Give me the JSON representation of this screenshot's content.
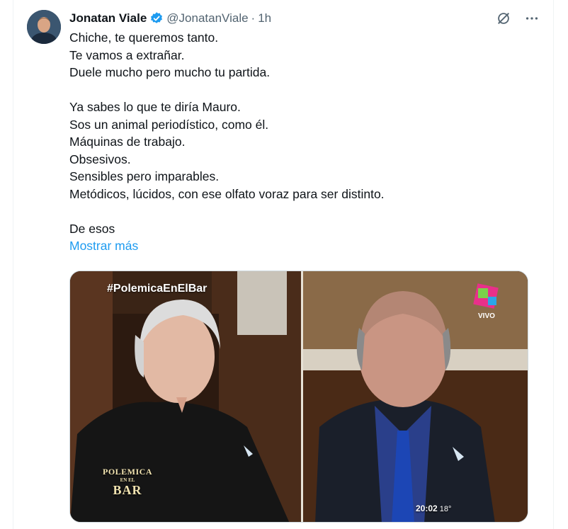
{
  "tweet": {
    "author": {
      "name": "Jonatan Viale",
      "handle": "@JonatanViale",
      "separator": "·",
      "time": "1h",
      "verified": true
    },
    "header_icons": [
      "grok-icon",
      "more-options-icon"
    ],
    "lines": [
      "Chiche, te queremos tanto.",
      "Te vamos a extrañar.",
      "Duele mucho pero mucho tu partida.",
      "",
      "Ya sabes lo que te diría Mauro.",
      "Sos un animal periodístico, como él.",
      "Máquinas de trabajo.",
      "Obsesivos.",
      "Sensibles pero imparables.",
      "Metódicos, lúcidos, con ese olfato voraz para ser distinto.",
      "",
      "De esos"
    ],
    "show_more": "Mostrar más",
    "media": {
      "hashtag": "#PolemicaEnElBar",
      "channel_badge": "VIVO",
      "clock": "20:02",
      "temperature": "18°",
      "logo": {
        "line1": "POLEMICA",
        "line2": "EN EL",
        "line3": "BAR"
      }
    }
  },
  "colors": {
    "text": "#0f1419",
    "secondary": "#536471",
    "link": "#1d9bf0",
    "verified": "#1d9bf0"
  }
}
